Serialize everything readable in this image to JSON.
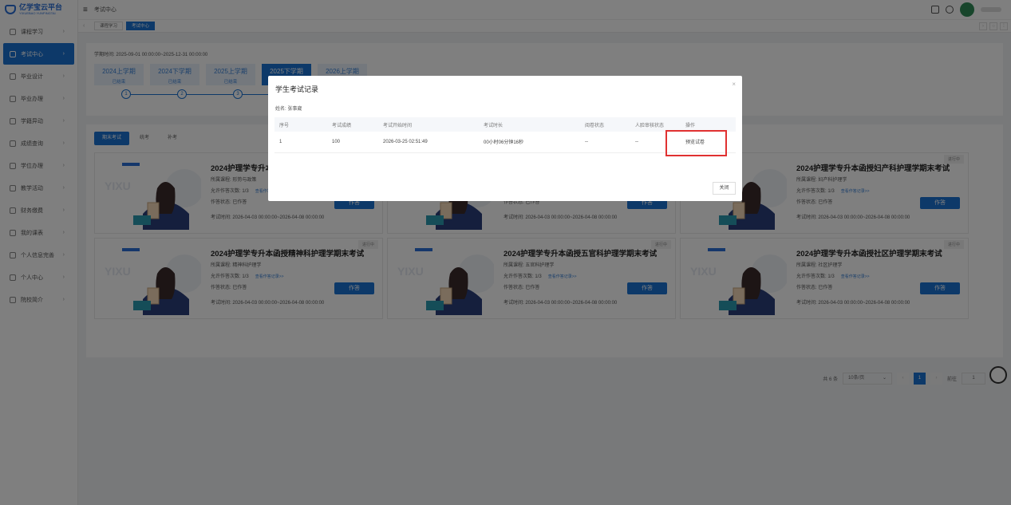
{
  "logo": {
    "name": "亿学宝云平台",
    "sub": "YIXUEBAO YUNPINGTAI"
  },
  "sidebar": {
    "items": [
      {
        "label": "课程学习",
        "active": false
      },
      {
        "label": "考试中心",
        "active": true
      },
      {
        "label": "毕业设计",
        "active": false
      },
      {
        "label": "毕业办理",
        "active": false
      },
      {
        "label": "学籍异动",
        "active": false
      },
      {
        "label": "成绩查询",
        "active": false
      },
      {
        "label": "学位办理",
        "active": false
      },
      {
        "label": "教学活动",
        "active": false
      },
      {
        "label": "财务缴费",
        "active": false
      },
      {
        "label": "我的课表",
        "active": false
      },
      {
        "label": "个人信息完善",
        "active": false
      },
      {
        "label": "个人中心",
        "active": false
      },
      {
        "label": "院校简介",
        "active": false
      }
    ]
  },
  "topbar": {
    "crumb": "考试中心"
  },
  "tabs": [
    {
      "label": "课程学习"
    },
    {
      "label": "考试中心"
    }
  ],
  "term_panel": {
    "date_range": "学期时间: 2025-09-01 00:00:00~2025-12-31 00:00:00",
    "terms": [
      {
        "name": "2024上学期",
        "status": "已结束"
      },
      {
        "name": "2024下学期",
        "status": "已结束"
      },
      {
        "name": "2025上学期",
        "status": "已结束"
      },
      {
        "name": "2025下学期",
        "status": ""
      },
      {
        "name": "2026上学期",
        "status": ""
      }
    ],
    "steps": [
      "1",
      "2",
      "3"
    ]
  },
  "exam_tabs": [
    {
      "label": "期末考试"
    },
    {
      "label": "统考"
    },
    {
      "label": "补考"
    }
  ],
  "cards": [
    {
      "title": "2024护理学专升本函",
      "course": "所属课程: 形势与政策",
      "attempts": "允许作答次数: 1/3",
      "link": "查看作答记录>>",
      "state": "作答状态: 已作答",
      "time": "考试时间: 2026-04-03 00:00:00~2026-04-08 00:00:00",
      "badge": "",
      "button": "作答"
    },
    {
      "title": "",
      "course": "",
      "attempts": "",
      "link": "",
      "state": "作答状态: 已作答",
      "time": "考试时间: 2026-04-03 00:00:00~2026-04-08 00:00:00",
      "badge": "",
      "button": "作答"
    },
    {
      "title": "2024护理学专升本函授妇产科护理学期末考试",
      "course": "所属课程: 妇产科护理学",
      "attempts": "允许作答次数: 1/3",
      "link": "查看作答记录>>",
      "state": "作答状态: 已作答",
      "time": "考试时间: 2026-04-03 00:00:00~2026-04-08 00:00:00",
      "badge": "进行中",
      "button": "作答"
    },
    {
      "title": "2024护理学专升本函授精神科护理学期末考试",
      "course": "所属课程: 精神科护理学",
      "attempts": "允许作答次数: 1/3",
      "link": "查看作答记录>>",
      "state": "作答状态: 已作答",
      "time": "考试时间: 2026-04-03 00:00:00~2026-04-08 00:00:00",
      "badge": "进行中",
      "button": "作答"
    },
    {
      "title": "2024护理学专升本函授五官科护理学期末考试",
      "course": "所属课程: 五官科护理学",
      "attempts": "允许作答次数: 1/3",
      "link": "查看作答记录>>",
      "state": "作答状态: 已作答",
      "time": "考试时间: 2026-04-03 00:00:00~2026-04-08 00:00:00",
      "badge": "进行中",
      "button": "作答"
    },
    {
      "title": "2024护理学专升本函授社区护理学期末考试",
      "course": "所属课程: 社区护理学",
      "attempts": "允许作答次数: 1/3",
      "link": "查看作答记录>>",
      "state": "作答状态: 已作答",
      "time": "考试时间: 2026-04-03 00:00:00~2026-04-08 00:00:00",
      "badge": "进行中",
      "button": "作答"
    }
  ],
  "pager": {
    "total": "共 6 条",
    "size": "10条/页",
    "current": "1",
    "goto_label": "前往",
    "goto_value": "1",
    "page_unit": "页"
  },
  "modal": {
    "title": "学生考试记录",
    "name": "姓名: 张事崴",
    "headers": [
      "序号",
      "考试成绩",
      "考试开始时间",
      "考试时长",
      "阅卷状态",
      "人脸审核状态",
      "操作"
    ],
    "rows": [
      [
        "1",
        "100",
        "2026-03-25 02:51:49",
        "00小时06分钟16秒",
        "--",
        "--",
        "预览试卷"
      ]
    ],
    "close": "关闭"
  },
  "colors": {
    "primary": "#1b73d3",
    "highlight": "#e03131"
  }
}
